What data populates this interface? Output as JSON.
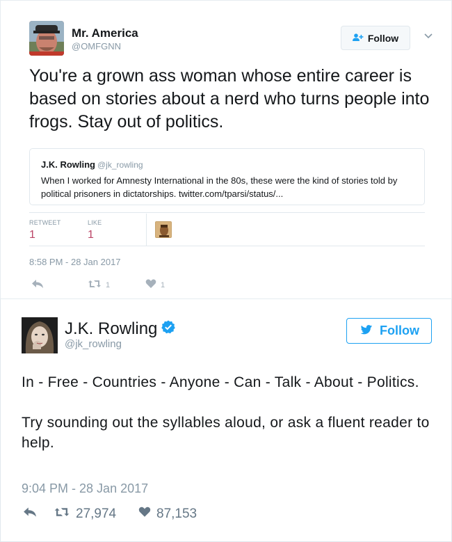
{
  "tweet1": {
    "author_name": "Mr. America",
    "author_handle": "@OMFGNN",
    "follow_label": "Follow",
    "text": "You're a grown ass woman whose entire career is based on stories about a nerd who turns people into frogs. Stay out of politics.",
    "quoted": {
      "author_name": "J.K. Rowling",
      "author_handle": "@jk_rowling",
      "text": "When I worked for Amnesty International in the 80s, these were the kind of stories told by political prisoners in dictatorships. twitter.com/tparsi/status/..."
    },
    "stats": {
      "retweet_label": "RETWEET",
      "retweet_count": "1",
      "like_label": "LIKE",
      "like_count": "1"
    },
    "timestamp": "8:58 PM - 28 Jan 2017",
    "actions": {
      "retweet_count": "1",
      "like_count": "1"
    }
  },
  "tweet2": {
    "author_name": "J.K. Rowling",
    "author_handle": "@jk_rowling",
    "follow_label": "Follow",
    "text_line1": "In - Free - Countries - Anyone - Can - Talk - About - Politics.",
    "text_line2": "Try sounding out the syllables aloud, or ask a fluent reader to help.",
    "timestamp": "9:04 PM - 28 Jan 2017",
    "actions": {
      "retweet_count": "27,974",
      "like_count": "87,153"
    }
  },
  "colors": {
    "twitter_blue": "#1da1f2",
    "like_red": "#bb4466",
    "muted_gray": "#8899a6"
  },
  "icons": [
    "follow-user-icon",
    "chevron-down-icon",
    "reply-icon",
    "retweet-icon",
    "heart-icon",
    "verified-badge-icon",
    "twitter-bird-icon"
  ]
}
